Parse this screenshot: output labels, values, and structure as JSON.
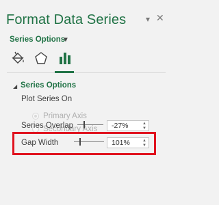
{
  "pane": {
    "title": "Format Data Series",
    "dropdown_glyph": "▾",
    "close_glyph": "✕"
  },
  "options_dropdown": {
    "label": "Series Options",
    "caret": "▼"
  },
  "tabs": [
    {
      "icon": "paint-bucket-icon",
      "name": "Fill & Line"
    },
    {
      "icon": "pentagon-icon",
      "name": "Effects"
    },
    {
      "icon": "bar-chart-icon",
      "name": "Series Options"
    }
  ],
  "section": {
    "toggle_glyph": "◢",
    "title": "Series Options",
    "plot_series_on_label": "Plot Series On",
    "radios": [
      {
        "label": "Primary Axis",
        "checked": true,
        "enabled": false
      },
      {
        "label": "Secondary Axis",
        "checked": false,
        "enabled": false
      }
    ],
    "series_overlap": {
      "label": "Series Overlap",
      "value": "-27%",
      "up": "▲",
      "down": "▼"
    },
    "gap_width": {
      "label": "Gap Width",
      "value": "101%",
      "up": "▲",
      "down": "▼"
    }
  },
  "colors": {
    "accent": "#217346",
    "highlight": "#e0131f",
    "background": "#f2f2f2"
  }
}
